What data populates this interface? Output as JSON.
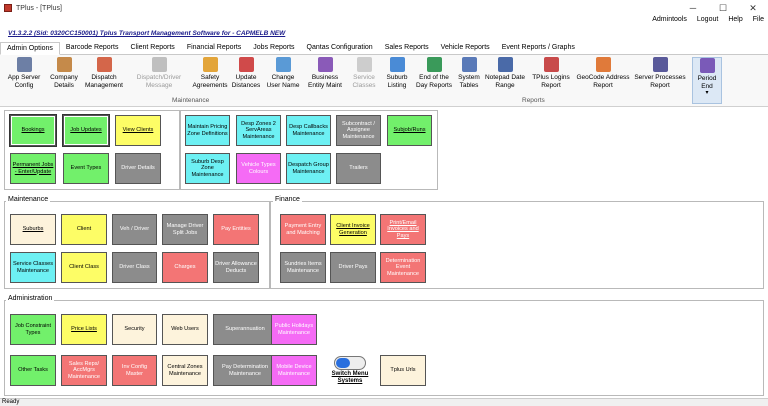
{
  "window": {
    "title": "TPlus - [TPlus]",
    "minimize": "─",
    "maximize": "☐",
    "close": "✕"
  },
  "topmenu": [
    "Admintools",
    "Logout",
    "Help",
    "File"
  ],
  "version": "V1.3.2.2 (Sid: 0320CC150001) Tplus Transport Management Software for - CAPMELB NEW",
  "tabs": [
    "Admin Options",
    "Barcode Reports",
    "Client Reports",
    "Financial Reports",
    "Jobs Reports",
    "Qantas Configuration",
    "Sales Reports",
    "Vehicle Reports",
    "Event Reports / Graphs"
  ],
  "ribbon": {
    "buttons": [
      {
        "label": "App Server Config",
        "icon": "server-icon",
        "color": "#6d7fa5"
      },
      {
        "label": "Company Details",
        "icon": "building-icon",
        "color": "#c58a4a"
      },
      {
        "label": "Dispatch Management",
        "icon": "dispatch-icon",
        "color": "#d4664a"
      },
      {
        "label": "Dispatch/Driver Message",
        "icon": "message-icon",
        "color": "#7a7a7a"
      },
      {
        "label": "Safety Agreements",
        "icon": "safety-icon",
        "color": "#e3a53a"
      },
      {
        "label": "Update Distances",
        "icon": "map-icon",
        "color": "#d04a4a"
      },
      {
        "label": "Change User Name",
        "icon": "user-edit-icon",
        "color": "#5a9ad6"
      },
      {
        "label": "Business Entity Maint",
        "icon": "tools-icon",
        "color": "#8a5ab8"
      },
      {
        "label": "Service Classes",
        "icon": "classes-icon",
        "color": "#9a9a9a"
      },
      {
        "label": "Suburb Listing",
        "icon": "location-icon",
        "color": "#4a8bd6"
      },
      {
        "label": "End of the Day Reports",
        "icon": "clock-icon",
        "color": "#3a9a5a"
      },
      {
        "label": "System Tables",
        "icon": "table-icon",
        "color": "#5a7ab8"
      },
      {
        "label": "Notepad Date Range",
        "icon": "notepad-icon",
        "color": "#4a6aa8"
      },
      {
        "label": "TPlus Logins Report",
        "icon": "login-icon",
        "color": "#c84a4a"
      },
      {
        "label": "GeoCode Address Report",
        "icon": "geocode-icon",
        "color": "#e07a3a"
      },
      {
        "label": "Server Processes Report",
        "icon": "process-icon",
        "color": "#5a5a9a"
      },
      {
        "label": "Period End",
        "icon": "calendar-icon",
        "color": "#7a5ab8"
      }
    ],
    "group_maintenance": "Maintenance",
    "group_reports": "Reports"
  },
  "sections": {
    "maintenance": "Maintenance",
    "finance": "Finance",
    "administration": "Administration"
  },
  "tiles": {
    "bookings": "Bookings",
    "job_updates": "Job Updates",
    "view_clients": "View Clients",
    "permanent_jobs": "Permanent Jobs - Enter/Update",
    "event_types": "Event Types",
    "driver_details": "Driver Details",
    "maintain_pricing": "Maintain Pricing Zone Definitions",
    "desp_zones_2": "Desp Zones 2 ServAreas Maintenance",
    "desp_callbacks": "Desp Callbacks Maintenance",
    "subcontract": "Subcontract / Assignee Maintenance",
    "subjob_runs": "Subjob/Runs",
    "suburb_desp_zone": "Suburb Desp Zone Maintenance",
    "vehicle_types_colours": "Vehicle Types Colours",
    "despatch_group": "Despatch Group Maintenance",
    "trailers": "Trailers",
    "suburbs": "Suburbs",
    "client": "Client",
    "veh_driver": "Veh / Driver",
    "manage_driver_split": "Manage Driver Split Jobs",
    "pay_entities": "Pay Entities",
    "service_classes_maint": "Service Classes Maintenance",
    "client_class": "Client Class",
    "driver_class": "Driver Class",
    "charges": "Charges",
    "driver_allowance": "Driver Allowance Deducts",
    "payment_entry": "Payment Entry and Matching",
    "client_invoice_gen": "Client Invoice Generation",
    "print_email_invoices": "Print/Email Invoices and Pays",
    "sundries_items": "Sundries Items Maintenance",
    "driver_pays": "Driver Pays",
    "determination_event": "Determination Event Maintenance",
    "job_constraint": "Job Constraint Types",
    "price_lists": "Price Lists",
    "security": "Security",
    "web_users": "Web Users",
    "superannuation": "Superannuation",
    "public_holidays": "Public Holidays Maintenance",
    "other_tasks": "Other Tasks",
    "sales_reps": "Sales Reps/ AccMgrs Maintenance",
    "inv_config_master": "Inv Config Master",
    "central_zones": "Central Zones Maintenance",
    "pay_determination": "Pay Determination Maintenance",
    "mobile_device": "Mobile Device Maintenance",
    "tplus_urls": "Tplus Urls"
  },
  "switch_menu": "Switch Menu Systems",
  "status": "Ready"
}
